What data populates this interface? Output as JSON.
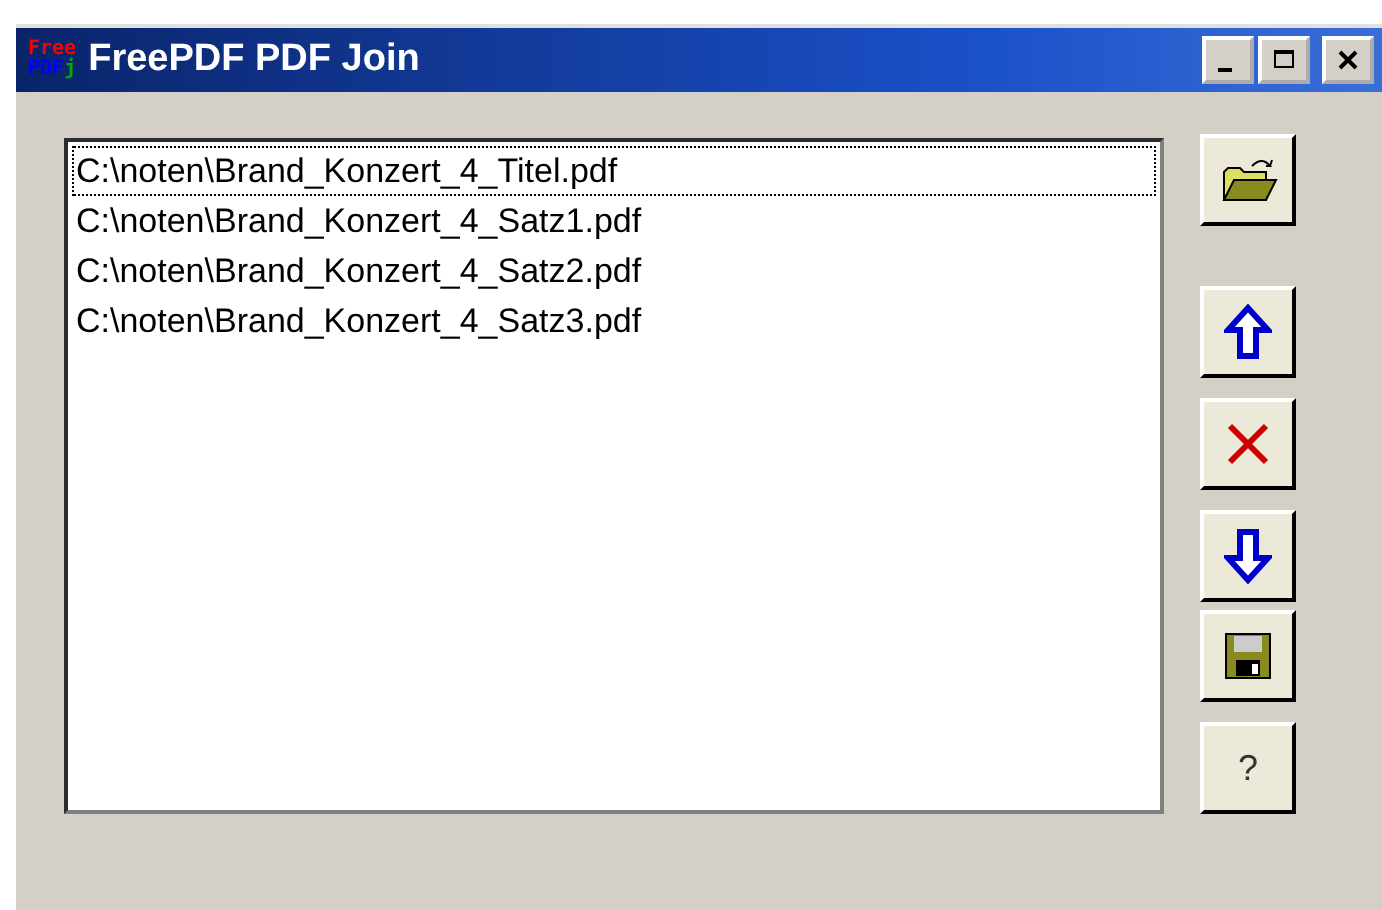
{
  "window": {
    "title": "FreePDF PDF Join",
    "logo": [
      "Free",
      "PDF",
      "j"
    ]
  },
  "file_list": [
    {
      "path": "C:\\noten\\Brand_Konzert_4_Titel.pdf",
      "focused": true
    },
    {
      "path": "C:\\noten\\Brand_Konzert_4_Satz1.pdf",
      "focused": false
    },
    {
      "path": "C:\\noten\\Brand_Konzert_4_Satz2.pdf",
      "focused": false
    },
    {
      "path": "C:\\noten\\Brand_Konzert_4_Satz3.pdf",
      "focused": false
    }
  ],
  "buttons": [
    {
      "kind": "open"
    },
    {
      "kind": "up"
    },
    {
      "kind": "delete"
    },
    {
      "kind": "down"
    },
    {
      "kind": "save"
    },
    {
      "kind": "help",
      "label": "?"
    }
  ]
}
